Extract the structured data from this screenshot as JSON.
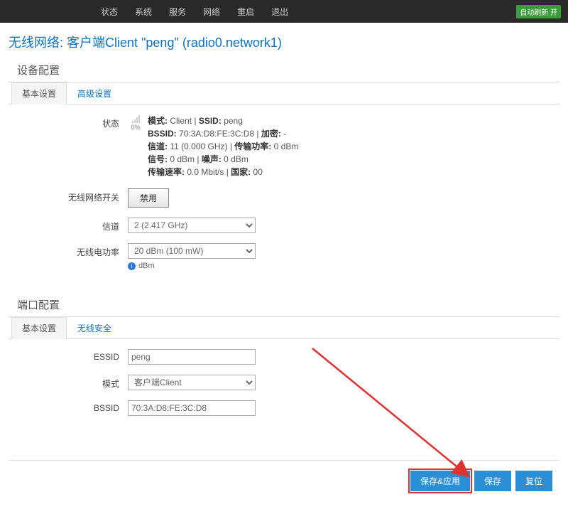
{
  "nav": {
    "items": [
      "状态",
      "系统",
      "服务",
      "网络",
      "重启",
      "退出"
    ],
    "refresh_badge": "自动刷新 开"
  },
  "title": "无线网络: 客户端Client \"peng\" (radio0.network1)",
  "device": {
    "section_title": "设备配置",
    "tabs": {
      "basic": "基本设置",
      "advanced": "高级设置"
    },
    "status_label": "状态",
    "signal_pct": "0%",
    "status": {
      "mode_label": "模式:",
      "mode": "Client",
      "ssid_label": "SSID:",
      "ssid": "peng",
      "bssid_label": "BSSID:",
      "bssid": "70:3A:D8:FE:3C:D8",
      "encryption_label": "加密:",
      "encryption": "-",
      "channel_label": "信道:",
      "channel": "11 (0.000 GHz)",
      "txpower_label": "传输功率:",
      "txpower": "0 dBm",
      "signal_label": "信号:",
      "signal": "0 dBm",
      "noise_label": "噪声:",
      "noise": "0 dBm",
      "rate_label": "传输速率:",
      "rate": "0.0 Mbit/s",
      "country_label": "国家:",
      "country": "00"
    },
    "switch_label": "无线网络开关",
    "disable_btn": "禁用",
    "channel_label": "信道",
    "channel_value": "2 (2.417 GHz)",
    "power_label": "无线电功率",
    "power_value": "20 dBm (100 mW)",
    "power_hint": "dBm"
  },
  "iface": {
    "section_title": "端口配置",
    "tabs": {
      "basic": "基本设置",
      "security": "无线安全"
    },
    "essid_label": "ESSID",
    "essid_value": "peng",
    "mode_label": "模式",
    "mode_value": "客户端Client",
    "bssid_label": "BSSID",
    "bssid_value": "70:3A:D8:FE:3C:D8"
  },
  "footer": {
    "save_apply": "保存&应用",
    "save": "保存",
    "reset": "复位"
  }
}
